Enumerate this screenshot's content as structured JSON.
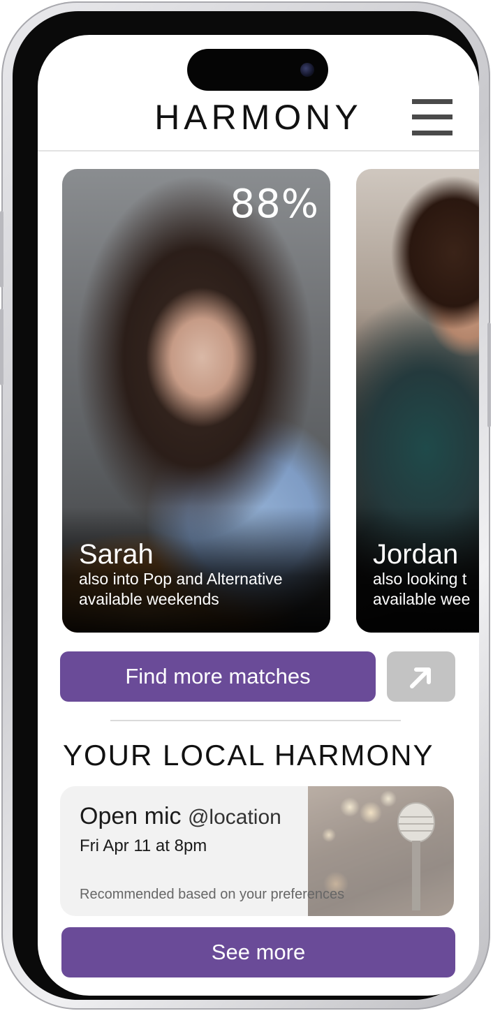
{
  "header": {
    "title": "HARMONY"
  },
  "matches": [
    {
      "name": "Sarah",
      "match_percent": "88%",
      "line1": "also into Pop and Alternative",
      "line2": "available weekends"
    },
    {
      "name": "Jordan",
      "line1": "also looking t",
      "line2": "available wee"
    }
  ],
  "actions": {
    "find_more_label": "Find more matches",
    "see_more_label": "See more"
  },
  "local": {
    "section_title": "YOUR LOCAL HARMONY",
    "event": {
      "title": "Open mic",
      "location": "@location",
      "date": "Fri Apr 11 at 8pm",
      "note": "Recommended based on your preferences"
    }
  },
  "colors": {
    "accent": "#6a4b98",
    "secondary_button": "#c3c3c3"
  },
  "icons": {
    "menu": "hamburger-menu-icon",
    "share": "arrow-up-right-icon",
    "event_image": "microphone-icon"
  }
}
